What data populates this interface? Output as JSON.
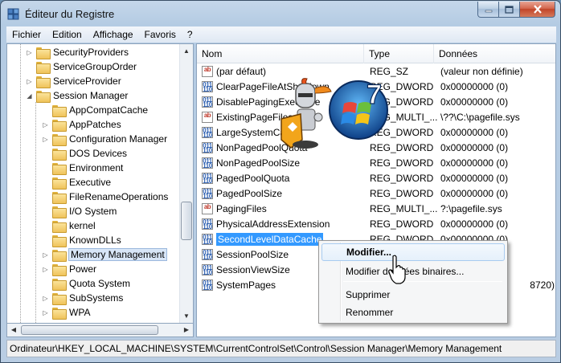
{
  "window": {
    "title": "Éditeur du Registre"
  },
  "menubar": {
    "items": [
      "Fichier",
      "Edition",
      "Affichage",
      "Favoris",
      "?"
    ]
  },
  "tree": {
    "items": [
      {
        "label": "SecurityProviders",
        "level": 1,
        "expander": "collapsed",
        "selected": false
      },
      {
        "label": "ServiceGroupOrder",
        "level": 1,
        "expander": "none",
        "selected": false
      },
      {
        "label": "ServiceProvider",
        "level": 1,
        "expander": "collapsed",
        "selected": false
      },
      {
        "label": "Session Manager",
        "level": 1,
        "expander": "expanded",
        "selected": false
      },
      {
        "label": "AppCompatCache",
        "level": 2,
        "expander": "none",
        "selected": false
      },
      {
        "label": "AppPatches",
        "level": 2,
        "expander": "collapsed",
        "selected": false
      },
      {
        "label": "Configuration Manager",
        "level": 2,
        "expander": "collapsed",
        "selected": false
      },
      {
        "label": "DOS Devices",
        "level": 2,
        "expander": "none",
        "selected": false
      },
      {
        "label": "Environment",
        "level": 2,
        "expander": "none",
        "selected": false
      },
      {
        "label": "Executive",
        "level": 2,
        "expander": "none",
        "selected": false
      },
      {
        "label": "FileRenameOperations",
        "level": 2,
        "expander": "none",
        "selected": false
      },
      {
        "label": "I/O System",
        "level": 2,
        "expander": "none",
        "selected": false
      },
      {
        "label": "kernel",
        "level": 2,
        "expander": "none",
        "selected": false
      },
      {
        "label": "KnownDLLs",
        "level": 2,
        "expander": "none",
        "selected": false
      },
      {
        "label": "Memory Management",
        "level": 2,
        "expander": "collapsed",
        "selected": true
      },
      {
        "label": "Power",
        "level": 2,
        "expander": "collapsed",
        "selected": false
      },
      {
        "label": "Quota System",
        "level": 2,
        "expander": "none",
        "selected": false
      },
      {
        "label": "SubSystems",
        "level": 2,
        "expander": "collapsed",
        "selected": false
      },
      {
        "label": "WPA",
        "level": 2,
        "expander": "collapsed",
        "selected": false
      }
    ]
  },
  "list": {
    "columns": [
      "Nom",
      "Type",
      "Données"
    ],
    "rows": [
      {
        "icon": "string-value-icon",
        "name": "(par défaut)",
        "type": "REG_SZ",
        "data": "(valeur non définie)"
      },
      {
        "icon": "binary-value-icon",
        "name": "ClearPageFileAtShutdown",
        "type": "REG_DWORD",
        "data": "0x00000000 (0)"
      },
      {
        "icon": "binary-value-icon",
        "name": "DisablePagingExecutive",
        "type": "REG_DWORD",
        "data": "0x00000000 (0)"
      },
      {
        "icon": "string-value-icon",
        "name": "ExistingPageFiles",
        "type": "REG_MULTI_...",
        "data": "\\??\\C:\\pagefile.sys"
      },
      {
        "icon": "binary-value-icon",
        "name": "LargeSystemCache",
        "type": "REG_DWORD",
        "data": "0x00000000 (0)"
      },
      {
        "icon": "binary-value-icon",
        "name": "NonPagedPoolQuota",
        "type": "REG_DWORD",
        "data": "0x00000000 (0)"
      },
      {
        "icon": "binary-value-icon",
        "name": "NonPagedPoolSize",
        "type": "REG_DWORD",
        "data": "0x00000000 (0)"
      },
      {
        "icon": "binary-value-icon",
        "name": "PagedPoolQuota",
        "type": "REG_DWORD",
        "data": "0x00000000 (0)"
      },
      {
        "icon": "binary-value-icon",
        "name": "PagedPoolSize",
        "type": "REG_DWORD",
        "data": "0x00000000 (0)"
      },
      {
        "icon": "string-value-icon",
        "name": "PagingFiles",
        "type": "REG_MULTI_...",
        "data": "?:\\pagefile.sys"
      },
      {
        "icon": "binary-value-icon",
        "name": "PhysicalAddressExtension",
        "type": "REG_DWORD",
        "data": "0x00000000 (0)"
      },
      {
        "icon": "binary-value-icon",
        "name": "SecondLevelDataCache",
        "type": "REG_DWORD",
        "data": "0x00000000 (0)"
      },
      {
        "icon": "binary-value-icon",
        "name": "SessionPoolSize",
        "type": "",
        "data": ""
      },
      {
        "icon": "binary-value-icon",
        "name": "SessionViewSize",
        "type": "",
        "data": ""
      },
      {
        "icon": "binary-value-icon",
        "name": "SystemPages",
        "type": "",
        "data": "8720)"
      }
    ],
    "selected_row": "SecondLevelDataCache"
  },
  "context_menu": {
    "items": [
      {
        "label": "Modifier...",
        "highlighted": true
      },
      {
        "label": "Modifier données binaires...",
        "highlighted": false
      },
      {
        "label": "Supprimer",
        "highlighted": false
      },
      {
        "label": "Renommer",
        "highlighted": false
      }
    ]
  },
  "statusbar": {
    "path": "Ordinateur\\HKEY_LOCAL_MACHINE\\SYSTEM\\CurrentControlSet\\Control\\Session Manager\\Memory Management"
  },
  "overlays": {
    "badge_text": "7"
  },
  "colors": {
    "selection": "#3399ff",
    "title_gradient_top": "#c5d7ea",
    "close_button": "#c24529"
  }
}
